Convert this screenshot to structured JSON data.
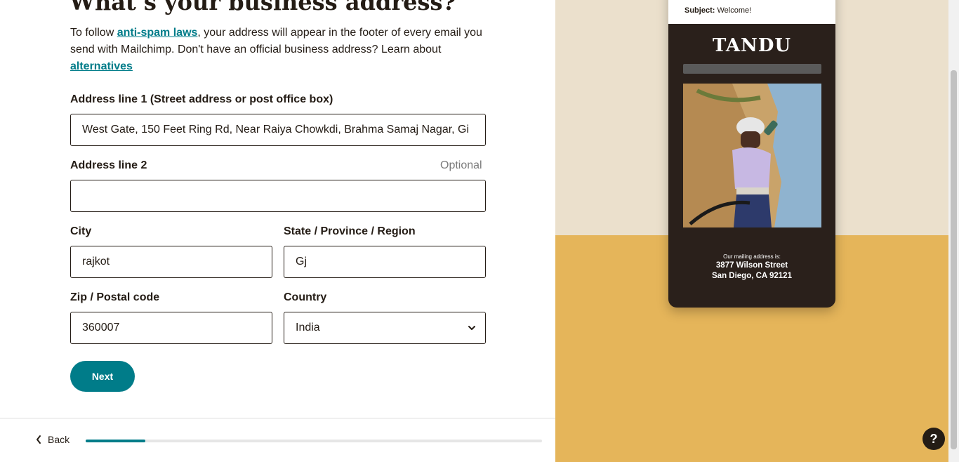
{
  "form": {
    "title": "What’s your business address?",
    "intro_before": "To follow ",
    "anti_spam_link": "anti-spam laws",
    "intro_middle": ", your address will appear in the footer of every email you send with Mailchimp. Don't have an official business address? Learn about ",
    "alternatives_link": "alternatives",
    "address1_label": "Address line 1 (Street address or post office box)",
    "address1_value": "West Gate, 150 Feet Ring Rd, Near Raiya Chowkdi, Brahma Samaj Nagar, Gi",
    "address2_label": "Address line 2",
    "address2_optional": "Optional",
    "address2_value": "",
    "city_label": "City",
    "city_value": "rajkot",
    "state_label": "State / Province / Region",
    "state_value": "Gj",
    "zip_label": "Zip / Postal code",
    "zip_value": "360007",
    "country_label": "Country",
    "country_value": "India",
    "next_label": "Next"
  },
  "footer": {
    "back_label": "Back",
    "progress": 0.13
  },
  "preview": {
    "subject_label": "Subject:",
    "subject_value": "Welcome!",
    "brand": "TANDU",
    "mailing_caption": "Our mailing address is:",
    "address_line1": "3877 Wilson Street",
    "address_line2": "San Diego, CA 92121"
  },
  "help": {
    "label": "?"
  },
  "colors": {
    "accent": "#007c89",
    "preview_top_bg": "#ebe0cc",
    "preview_bottom_bg": "#e5b55a",
    "phone_bg": "#2a201b"
  },
  "icons": {
    "back": "chevron-left-icon",
    "country_select": "chevron-down-icon",
    "help": "question-mark-icon"
  }
}
